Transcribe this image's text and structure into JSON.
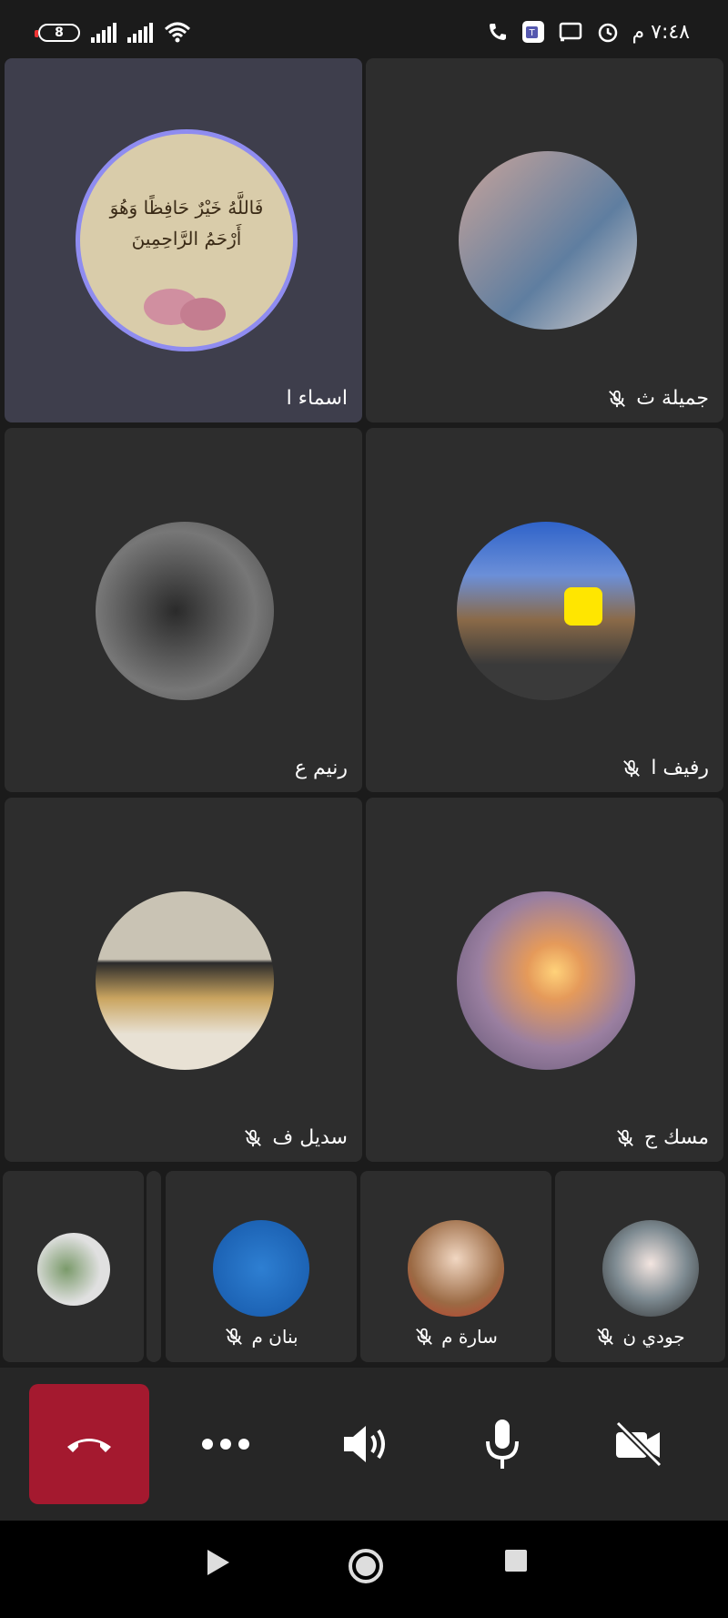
{
  "status_bar": {
    "battery": "8",
    "time": "٧:٤٨ م",
    "icons": [
      "phone-icon",
      "teams-icon",
      "cast-icon",
      "alarm-icon",
      "wifi-icon",
      "signal-icon"
    ]
  },
  "participants": [
    {
      "name": "اسماء ا",
      "muted": false,
      "active": true,
      "avatar_text": "فَاللَّهُ خَيْرٌ حَافِظًا وَهُوَ أَرْحَمُ الرَّاحِمِينَ"
    },
    {
      "name": "جميلة ث",
      "muted": true
    },
    {
      "name": "رنيم ع",
      "muted": false
    },
    {
      "name": "رفيف ا",
      "muted": true
    },
    {
      "name": "سديل ف",
      "muted": true
    },
    {
      "name": "مسك ج",
      "muted": true
    }
  ],
  "overflow_participants": [
    {
      "name": "",
      "muted": false
    },
    {
      "name": "بنان م",
      "muted": true
    },
    {
      "name": "سارة م",
      "muted": true
    },
    {
      "name": "جودي ن",
      "muted": true
    }
  ],
  "controls": {
    "hangup": "hang-up-icon",
    "more": "more-icon",
    "speaker": "speaker-icon",
    "mic": "microphone-icon",
    "camera": "camera-off-icon"
  },
  "colors": {
    "hangup": "#a4192f",
    "active_ring": "#8f8cf0",
    "tile": "#2d2d2d"
  }
}
